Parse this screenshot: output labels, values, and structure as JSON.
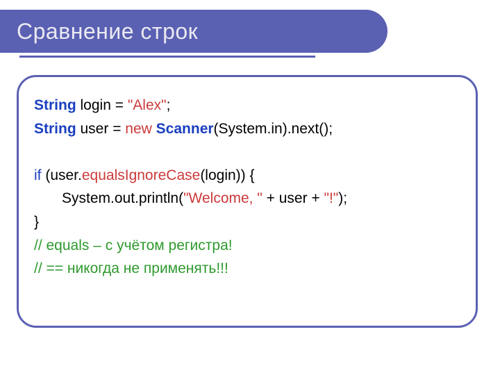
{
  "title": "Сравнение строк",
  "code": {
    "l1": {
      "type": "String",
      "rest1": " login = ",
      "str": "\"Alex\"",
      "rest2": ";"
    },
    "l2": {
      "type": "String",
      "rest1": " user = ",
      "newkw": "new",
      "sp": " ",
      "cls": "Scanner",
      "rest2": "(System.in).next();"
    },
    "l3": {
      "blank": " "
    },
    "l4": {
      "ifkw": "if",
      "rest1": " (user.",
      "method": "equalsIgnoreCase",
      "rest2": "(login)) {"
    },
    "l5": {
      "rest1": "System.out.println(",
      "str1": "\"Welcome, \"",
      "mid": " + user + ",
      "str2": "\"!\"",
      "rest2": ");"
    },
    "l6": {
      "brace": "}"
    },
    "l7": {
      "comment": "// equals – с учётом регистра!"
    },
    "l8": {
      "comment": "// == никогда не применять!!!"
    }
  }
}
